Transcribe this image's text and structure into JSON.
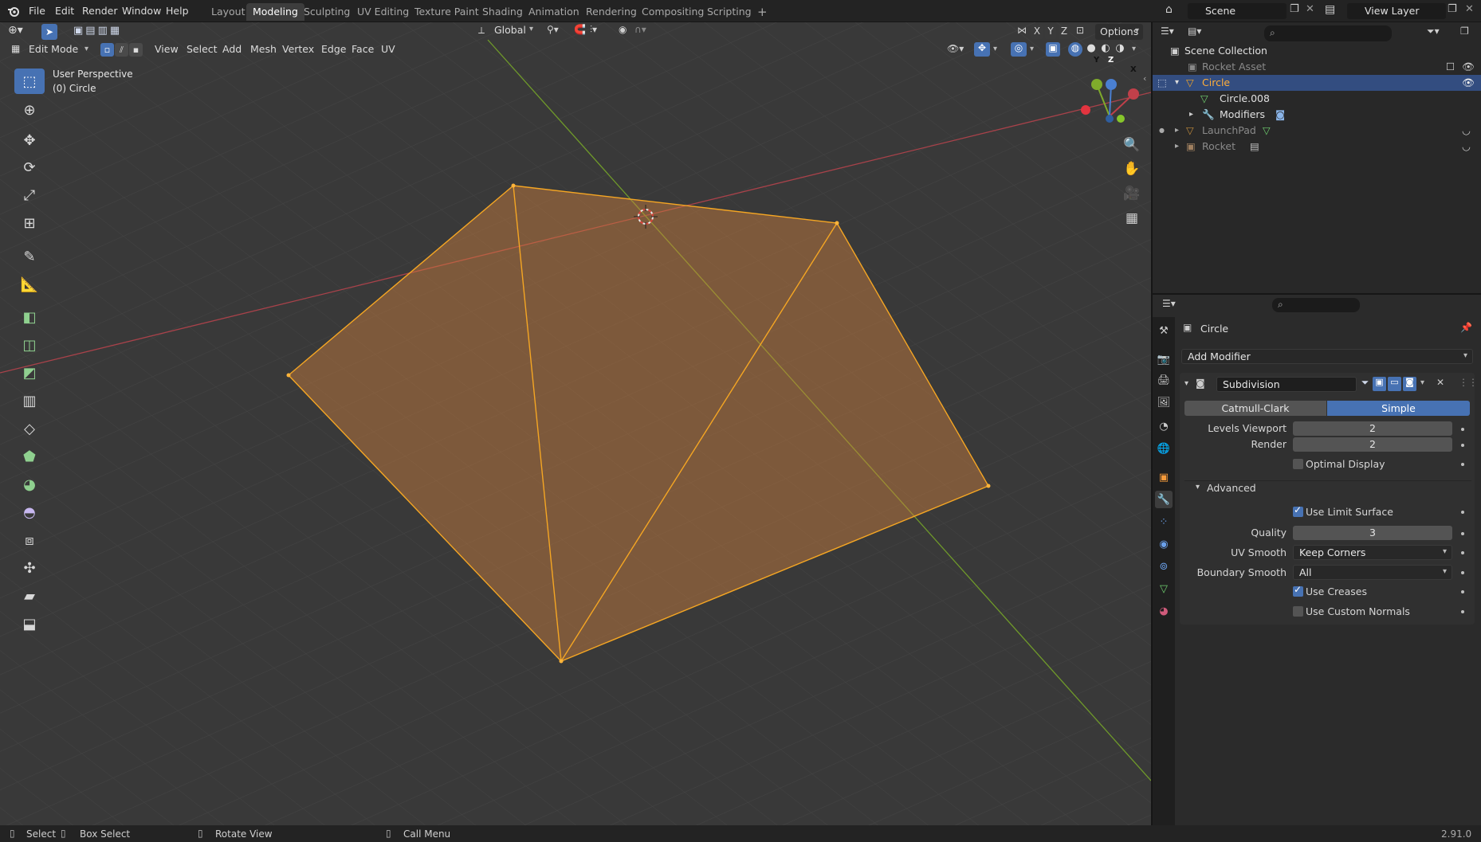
{
  "app": {
    "menu": [
      "File",
      "Edit",
      "Render",
      "Window",
      "Help"
    ],
    "workspace_tabs": [
      {
        "label": "Layout",
        "active": false
      },
      {
        "label": "Modeling",
        "active": true
      },
      {
        "label": "Sculpting",
        "active": false
      },
      {
        "label": "UV Editing",
        "active": false
      },
      {
        "label": "Texture Paint",
        "active": false
      },
      {
        "label": "Shading",
        "active": false
      },
      {
        "label": "Animation",
        "active": false
      },
      {
        "label": "Rendering",
        "active": false
      },
      {
        "label": "Compositing",
        "active": false
      },
      {
        "label": "Scripting",
        "active": false
      }
    ],
    "add_workspace": "+",
    "scene_name": "Scene",
    "view_layer": "View Layer"
  },
  "viewport": {
    "mode": "Edit Mode",
    "menus": [
      "View",
      "Select",
      "Add",
      "Mesh",
      "Vertex",
      "Edge",
      "Face",
      "UV"
    ],
    "orientation": "Global",
    "axis_toggles": [
      "X",
      "Y",
      "Z"
    ],
    "options_label": "Options",
    "perspective": "User Perspective",
    "object_label": "(0) Circle",
    "gizmo_labels": {
      "y": "Y",
      "z": "Z",
      "x": "X"
    }
  },
  "outliner": {
    "items": [
      {
        "label": "Scene Collection",
        "type": "collection"
      },
      {
        "label": "Rocket Asset",
        "type": "collection",
        "dimmed": true
      },
      {
        "label": "Circle",
        "type": "mesh-object",
        "selected": true
      },
      {
        "label": "Circle.008",
        "type": "mesh-data"
      },
      {
        "label": "Modifiers",
        "type": "modifiers"
      },
      {
        "label": "LaunchPad",
        "type": "mesh-object",
        "dimmed": true
      },
      {
        "label": "Rocket",
        "type": "collection",
        "dimmed": true
      }
    ]
  },
  "properties": {
    "object_name": "Circle",
    "add_modifier": "Add Modifier",
    "modifier_name": "Subdivision",
    "algorithms": [
      {
        "label": "Catmull-Clark",
        "active": false
      },
      {
        "label": "Simple",
        "active": true
      }
    ],
    "levels_viewport_label": "Levels Viewport",
    "levels_viewport": "2",
    "render_label": "Render",
    "render_value": "2",
    "optimal_display_label": "Optimal Display",
    "optimal_display": false,
    "advanced_label": "Advanced",
    "use_limit_surface_label": "Use Limit Surface",
    "use_limit_surface": true,
    "quality_label": "Quality",
    "quality": "3",
    "uv_smooth_label": "UV Smooth",
    "uv_smooth": "Keep Corners",
    "boundary_smooth_label": "Boundary Smooth",
    "boundary_smooth": "All",
    "use_creases_label": "Use Creases",
    "use_creases": true,
    "use_custom_normals_label": "Use Custom Normals",
    "use_custom_normals": false
  },
  "status": {
    "select": "Select",
    "box_select": "Box Select",
    "rotate_view": "Rotate View",
    "call_menu": "Call Menu",
    "version": "2.91.0"
  },
  "colors": {
    "accent": "#4772b3",
    "selection_orange": "#f5a623",
    "axis_x": "#c0404a",
    "axis_y": "#7fab2b",
    "axis_z": "#4a7fd1"
  }
}
